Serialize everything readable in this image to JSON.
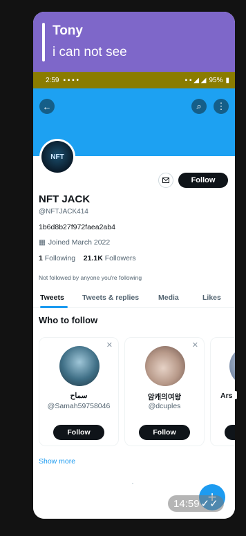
{
  "reply": {
    "name": "Tony",
    "text": "i can not see"
  },
  "status_bar": {
    "time": "2:59",
    "battery": "95%"
  },
  "profile": {
    "avatar_text": "NFT",
    "name": "NFT JACK",
    "handle": "@NFTJACK414",
    "bio": "1b6d8b27f972faea2ab4",
    "joined": "Joined March 2022",
    "following_count": "1",
    "following_label": "Following",
    "followers_count": "21.1K",
    "followers_label": "Followers",
    "not_followed_text": "Not followed by anyone you're following",
    "follow_label": "Follow"
  },
  "tabs": [
    "Tweets",
    "Tweets & replies",
    "Media",
    "Likes"
  ],
  "who_to_follow": {
    "title": "Who to follow",
    "cards": [
      {
        "name": "سماح",
        "handle": "@Samah59758046",
        "button": "Follow"
      },
      {
        "name": "암캐의여왕",
        "handle": "@dcuples",
        "button": "Follow"
      },
      {
        "name": "Arsl",
        "handle": "",
        "button": ""
      }
    ],
    "show_more": "Show more"
  },
  "message_time": "14:59",
  "colors": {
    "reply_bg": "#7e67c9",
    "status_bar": "#8a7c00",
    "banner": "#1da1f2",
    "accent": "#1d9bf0"
  }
}
